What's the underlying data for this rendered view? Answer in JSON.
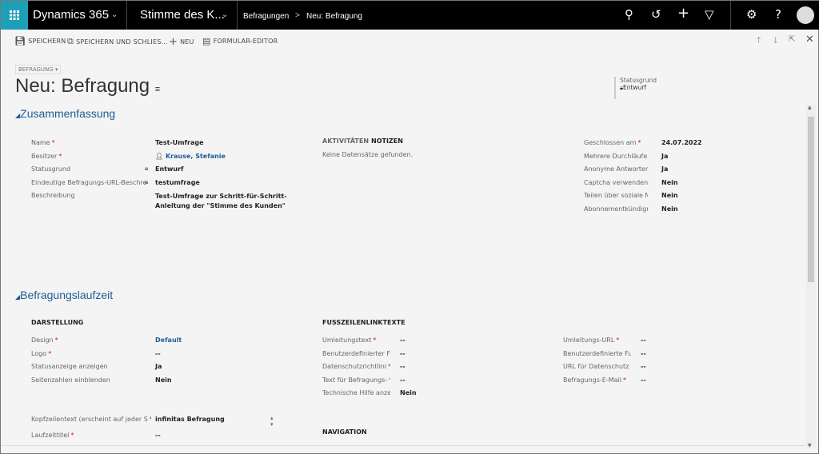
{
  "topbar": {
    "app": "Dynamics 365",
    "area": "Stimme des K...",
    "breadcrumb": [
      "Befragungen",
      "Neu: Befragung"
    ],
    "breadcrumb_sep": ">"
  },
  "commands": [
    {
      "icon": "save-icon",
      "label": "SPEICHERN"
    },
    {
      "icon": "save-close-icon",
      "label": "SPEICHERN UND SCHLIES..."
    },
    {
      "icon": "plus-icon",
      "label": "NEU"
    },
    {
      "icon": "form-editor-icon",
      "label": "FORMULAR-EDITOR"
    }
  ],
  "header": {
    "form_selector": "BEFRAGUNG",
    "title": "Neu: Befragung",
    "status_label": "Statusgrund",
    "status_value": "Entwurf"
  },
  "summary": {
    "title": "Zusammenfassung",
    "fields": [
      {
        "label": "Name",
        "required": true,
        "value": "Test-Umfrage"
      },
      {
        "label": "Besitzer",
        "required": true,
        "value": "Krause, Stefanie",
        "link": true,
        "user": true
      },
      {
        "label": "Statusgrund",
        "required": false,
        "value": "Entwurf",
        "locked": true
      },
      {
        "label": "Eindeutige Befragungs-URL-Beschre",
        "required": true,
        "value": "testumfrage",
        "locked": true
      },
      {
        "label": "Beschreibung",
        "required": false,
        "value": "Test-Umfrage zur Schritt-für-Schritt-",
        "value2": "Anleitung der \"Stimme des Kunden\""
      }
    ],
    "tabs": [
      "AKTIVITÄTEN",
      "NOTIZEN"
    ],
    "empty_text": "Keine Datensätze gefunden.",
    "right_fields": [
      {
        "label": "Geschlossen am",
        "required": true,
        "value": "24.07.2022"
      },
      {
        "label": "Mehrere Durchläufe",
        "required": true,
        "value": "Ja"
      },
      {
        "label": "Anonyme Antworten",
        "required": true,
        "value": "Ja"
      },
      {
        "label": "Captcha verwenden",
        "required": false,
        "value": "Nein"
      },
      {
        "label": "Teilen über soziale Me",
        "required": false,
        "value": "Nein"
      },
      {
        "label": "Abonnementkündigu",
        "required": false,
        "value": "Nein"
      }
    ]
  },
  "runtime": {
    "title": "Befragungslaufzeit",
    "display_title": "DARSTELLUNG",
    "display_fields": [
      {
        "label": "Design",
        "required": true,
        "value": "Default",
        "link": true
      },
      {
        "label": "Logo",
        "required": true,
        "value": "--"
      },
      {
        "label": "Statusanzeige anzeigen",
        "required": false,
        "value": "Ja"
      },
      {
        "label": "Seitenzahlen einblenden",
        "required": false,
        "value": "Nein"
      }
    ],
    "header_fields": [
      {
        "label": "Kopfzeilentext (erscheint auf jeder S",
        "required": true,
        "value": "infinitas Befragung"
      },
      {
        "label": "Laufzeittitel",
        "required": true,
        "value": "--"
      }
    ],
    "footer_title": "FUSSZEILENLINKTEXTE",
    "footer_fields": [
      {
        "label": "Umleitungstext",
        "required": true,
        "value": "--"
      },
      {
        "label": "Benutzerdefinierter Fu",
        "required": false,
        "value": "--"
      },
      {
        "label": "Datenschutzrichtlini",
        "required": true,
        "value": "--"
      },
      {
        "label": "Text für Befragungs-",
        "required": true,
        "value": "--"
      },
      {
        "label": "Technische Hilfe anzei",
        "required": false,
        "value": "Nein"
      }
    ],
    "footer_right_fields": [
      {
        "label": "Umleitungs-URL",
        "required": true,
        "value": "--"
      },
      {
        "label": "Benutzerdefinierte Ful",
        "required": false,
        "value": "--"
      },
      {
        "label": "URL für Datenschutz",
        "required": true,
        "value": "--"
      },
      {
        "label": "Befragungs-E-Mail",
        "required": true,
        "value": "--"
      }
    ],
    "navigation_title": "NAVIGATION"
  },
  "colors": {
    "accent": "#1e9fb8",
    "link": "#1e5c96",
    "required": "#c0143c"
  }
}
